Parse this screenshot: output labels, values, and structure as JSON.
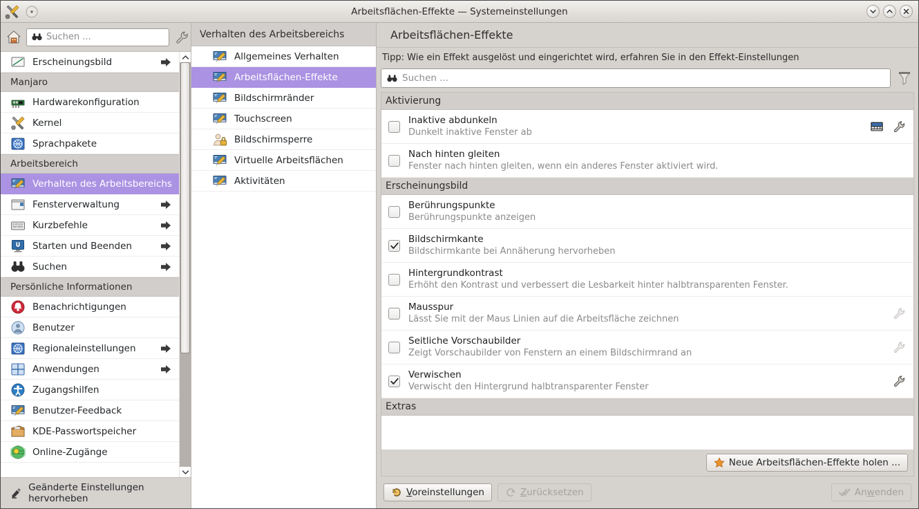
{
  "window": {
    "title": "Arbeitsflächen-Effekte — Systemeinstellungen",
    "titlebar_icons": [
      "tools-icon",
      "dot-icon"
    ],
    "controls": [
      {
        "name": "minimize-button",
        "glyph": "chevron-down-icon"
      },
      {
        "name": "maximize-button",
        "glyph": "chevron-up-icon"
      },
      {
        "name": "close-button",
        "glyph": "close-icon"
      }
    ],
    "accent_color": "#ab92e3",
    "chrome_color": "#d6d2ce"
  },
  "sidebar": {
    "home_icon": "home-icon",
    "search": {
      "placeholder": "Suchen ...",
      "value": "",
      "icon": "binoculars-icon"
    },
    "configure_icon": "wrench-icon",
    "items": [
      {
        "label": "Erscheinungsbild",
        "icon": "appearance-icon",
        "arrow": true,
        "selected": false,
        "type": "item"
      },
      {
        "label": "Manjaro",
        "type": "section"
      },
      {
        "label": "Hardwarekonfiguration",
        "icon": "hardware-icon",
        "arrow": false,
        "selected": false,
        "type": "item"
      },
      {
        "label": "Kernel",
        "icon": "tools-icon",
        "arrow": false,
        "selected": false,
        "type": "item"
      },
      {
        "label": "Sprachpakete",
        "icon": "flag-icon",
        "arrow": false,
        "selected": false,
        "type": "item"
      },
      {
        "label": "Arbeitsbereich",
        "type": "section"
      },
      {
        "label": "Verhalten des Arbeitsbereichs",
        "icon": "desktop-tools-icon",
        "arrow": true,
        "selected": true,
        "type": "item"
      },
      {
        "label": "Fensterverwaltung",
        "icon": "window-icon",
        "arrow": true,
        "selected": false,
        "type": "item"
      },
      {
        "label": "Kurzbefehle",
        "icon": "keyboard-icon",
        "arrow": true,
        "selected": false,
        "type": "item"
      },
      {
        "label": "Starten und Beenden",
        "icon": "power-icon",
        "arrow": true,
        "selected": false,
        "type": "item"
      },
      {
        "label": "Suchen",
        "icon": "binoculars-icon",
        "arrow": true,
        "selected": false,
        "type": "item"
      },
      {
        "label": "Persönliche Informationen",
        "type": "section"
      },
      {
        "label": "Benachrichtigungen",
        "icon": "bell-icon",
        "arrow": false,
        "selected": false,
        "type": "item"
      },
      {
        "label": "Benutzer",
        "icon": "user-icon",
        "arrow": false,
        "selected": false,
        "type": "item"
      },
      {
        "label": "Regionaleinstellungen",
        "icon": "flag-icon",
        "arrow": true,
        "selected": false,
        "type": "item"
      },
      {
        "label": "Anwendungen",
        "icon": "apps-icon",
        "arrow": true,
        "selected": false,
        "type": "item"
      },
      {
        "label": "Zugangshilfen",
        "icon": "accessibility-icon",
        "arrow": false,
        "selected": false,
        "type": "item"
      },
      {
        "label": "Benutzer-Feedback",
        "icon": "desktop-tools-icon",
        "arrow": false,
        "selected": false,
        "type": "item"
      },
      {
        "label": "KDE-Passwortspeicher",
        "icon": "wallet-icon",
        "arrow": false,
        "selected": false,
        "type": "item"
      },
      {
        "label": "Online-Zugänge",
        "icon": "globe-icon",
        "arrow": false,
        "selected": false,
        "type": "item"
      }
    ],
    "footer": {
      "label": "Geänderte Einstellungen hervorheben",
      "icon": "highlighter-icon"
    },
    "scrollbar": {
      "thumb_top_pct": 0,
      "thumb_height_pct": 72
    }
  },
  "midcol": {
    "header": "Verhalten des Arbeitsbereichs",
    "items": [
      {
        "label": "Allgemeines Verhalten",
        "icon": "desktop-tools-icon",
        "selected": false
      },
      {
        "label": "Arbeitsflächen-Effekte",
        "icon": "desktop-tools-icon",
        "selected": true
      },
      {
        "label": "Bildschirmränder",
        "icon": "desktop-tools-icon",
        "selected": false
      },
      {
        "label": "Touchscreen",
        "icon": "desktop-tools-icon",
        "selected": false
      },
      {
        "label": "Bildschirmsperre",
        "icon": "lock-user-icon",
        "selected": false
      },
      {
        "label": "Virtuelle Arbeitsflächen",
        "icon": "desktop-tools-icon",
        "selected": false
      },
      {
        "label": "Aktivitäten",
        "icon": "desktop-tools-icon",
        "selected": false
      }
    ]
  },
  "main": {
    "title": "Arbeitsflächen-Effekte",
    "tip": "Tipp: Wie ein Effekt ausgelöst und eingerichtet wird, erfahren Sie in den Effekt-Einstellungen",
    "search": {
      "placeholder": "Suchen ...",
      "value": "",
      "icon": "binoculars-icon"
    },
    "filter_icon": "funnel-icon",
    "groups": [
      {
        "title": "Aktivierung",
        "effects": [
          {
            "name": "Inaktive abdunkeln",
            "description": "Dunkelt inaktive Fenster ab",
            "checked": false,
            "icons": [
              "video-icon",
              "wrench-icon"
            ]
          },
          {
            "name": "Nach hinten gleiten",
            "description": "Fenster nach hinten gleiten, wenn ein anderes Fenster aktiviert wird.",
            "checked": false,
            "icons": []
          }
        ]
      },
      {
        "title": "Erscheinungsbild",
        "effects": [
          {
            "name": "Berührungspunkte",
            "description": "Berührungspunkte anzeigen",
            "checked": false,
            "icons": []
          },
          {
            "name": "Bildschirmkante",
            "description": "Bildschirmkante bei Annäherung hervorheben",
            "checked": true,
            "icons": []
          },
          {
            "name": "Hintergrundkontrast",
            "description": "Erhöht den Kontrast und verbessert die Lesbarkeit hinter halbtransparenten Fenster.",
            "checked": false,
            "icons": []
          },
          {
            "name": "Mausspur",
            "description": "Lässt Sie mit der Maus Linien auf die Arbeitsfläche zeichnen",
            "checked": false,
            "icons": [
              "wrench-icon-disabled"
            ]
          },
          {
            "name": "Seitliche Vorschaubilder",
            "description": "Zeigt Vorschaubilder von Fenstern an einem Bildschirmrand an",
            "checked": false,
            "icons": [
              "wrench-icon-disabled"
            ]
          },
          {
            "name": "Verwischen",
            "description": "Verwischt den Hintergrund halbtransparenter Fenster",
            "checked": true,
            "icons": [
              "wrench-icon"
            ]
          }
        ]
      },
      {
        "title": "Extras",
        "effects": []
      }
    ],
    "get_new_button": {
      "label": "Neue Arbeitsflächen-Effekte holen ...",
      "icon": "star-icon"
    }
  },
  "bottombar": {
    "defaults_button": {
      "label_pre": "",
      "label_underline": "V",
      "label_post": "oreinstellungen",
      "icon": "undo-icon",
      "enabled": true
    },
    "reset_button": {
      "label_pre": "",
      "label_underline": "Z",
      "label_post": "urücksetzen",
      "icon": "reset-icon",
      "enabled": false
    },
    "apply_button": {
      "label_pre": "An",
      "label_underline": "w",
      "label_post": "enden",
      "icon": "check-icon",
      "enabled": false
    }
  }
}
